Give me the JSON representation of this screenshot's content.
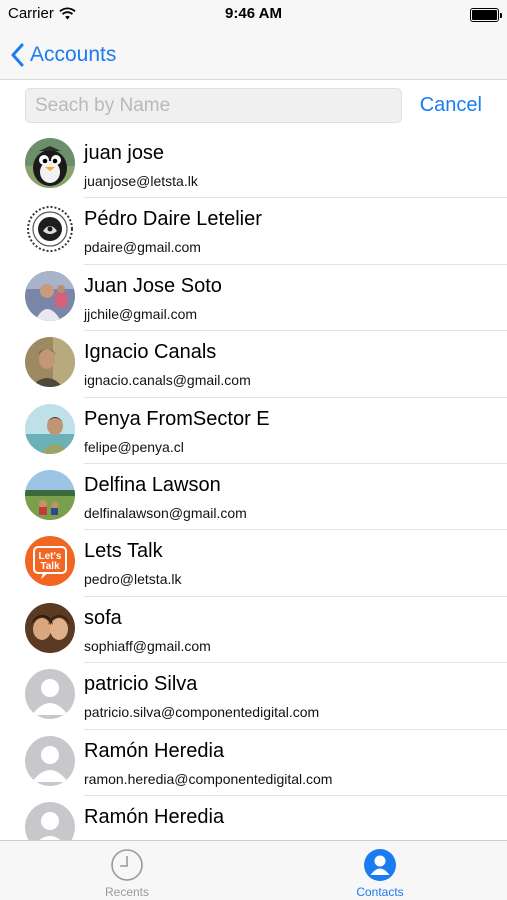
{
  "status_bar": {
    "carrier": "Carrier",
    "time": "9:46 AM",
    "wifi_icon": "wifi-icon",
    "battery_icon": "battery-icon"
  },
  "nav": {
    "back_label": "Accounts",
    "back_icon": "chevron-left-icon"
  },
  "search": {
    "placeholder": "Seach by Name",
    "value": "",
    "cancel_label": "Cancel"
  },
  "contacts": [
    {
      "name": "juan jose",
      "email": "juanjose@letsta.lk",
      "avatar": "penguin-avatar"
    },
    {
      "name": "Pédro Daire Letelier",
      "email": "pdaire@gmail.com",
      "avatar": "emblem-avatar"
    },
    {
      "name": "Juan Jose Soto",
      "email": "jjchile@gmail.com",
      "avatar": "photo-avatar"
    },
    {
      "name": "Ignacio Canals",
      "email": "ignacio.canals@gmail.com",
      "avatar": "photo-avatar"
    },
    {
      "name": "Penya FromSector E",
      "email": "felipe@penya.cl",
      "avatar": "photo-avatar"
    },
    {
      "name": "Delfina Lawson",
      "email": "delfinalawson@gmail.com",
      "avatar": "photo-avatar"
    },
    {
      "name": "Lets Talk",
      "email": "pedro@letsta.lk",
      "avatar": "letstalk-logo",
      "logo_text": "Let's Talk"
    },
    {
      "name": "sofa",
      "email": "sophiaff@gmail.com",
      "avatar": "photo-avatar"
    },
    {
      "name": "patricio Silva",
      "email": "patricio.silva@componentedigital.com",
      "avatar": "default-person-avatar"
    },
    {
      "name": "Ramón Heredia",
      "email": "ramon.heredia@componentedigital.com",
      "avatar": "default-person-avatar"
    },
    {
      "name": "Ramón Heredia",
      "email": "",
      "avatar": "default-person-avatar"
    }
  ],
  "tabs": [
    {
      "label": "Recents",
      "icon": "clock-icon",
      "selected": false
    },
    {
      "label": "Contacts",
      "icon": "person-icon",
      "selected": true
    }
  ],
  "colors": {
    "accent": "#1b7cf2",
    "letstalk_orange": "#f26522",
    "inactive_tab": "#9a9a9a"
  }
}
